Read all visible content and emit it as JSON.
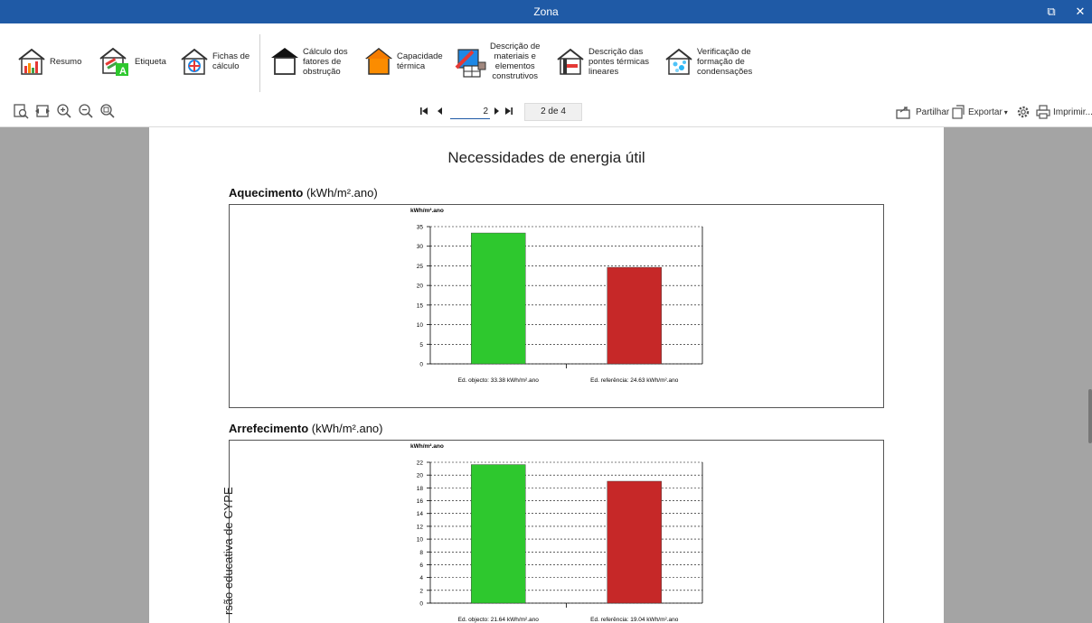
{
  "window": {
    "title": "Zona",
    "restore_glyph": "⧉",
    "close_glyph": "✕"
  },
  "ribbon": {
    "items": [
      {
        "label": "Resumo",
        "icon": "summary-chart-icon"
      },
      {
        "label": "Etiqueta",
        "icon": "label-icon"
      },
      {
        "label": "Fichas de\ncálculo",
        "icon": "calculation-sheets-icon"
      },
      {
        "label": "Cálculo dos\nfatores de\nobstrução",
        "icon": "obstruction-icon"
      },
      {
        "label": "Capacidade\ntérmica",
        "icon": "thermal-capacity-icon"
      },
      {
        "label": "Descrição de\nmateriais e\nelementos\nconstrutivos",
        "icon": "materials-icon"
      },
      {
        "label": "Descrição das\npontes térmicas\nlineares",
        "icon": "thermal-bridges-icon"
      },
      {
        "label": "Verificação de\nformação de\ncondensações",
        "icon": "condensation-icon"
      }
    ]
  },
  "toolbar": {
    "current_page": "2",
    "page_count": "2 de 4",
    "share_label": "Partilhar",
    "export_label": "Exportar",
    "print_label": "Imprimir..."
  },
  "document": {
    "heading": "Necessidades de energia útil",
    "watermark": "rsão educativa de CYPE",
    "sections": [
      {
        "title": "Aquecimento",
        "unit": "(kWh/m².ano)"
      },
      {
        "title": "Arrefecimento",
        "unit": "(kWh/m².ano)"
      }
    ]
  },
  "chart_data": [
    {
      "type": "bar",
      "ylabel": "kWh/m².ano",
      "categories": [
        "Ed. objecto: 33.38 kWh/m².ano",
        "Ed. referência: 24.63 kWh/m².ano"
      ],
      "values": [
        33.38,
        24.63
      ],
      "colors": [
        "#2ec82e",
        "#c62828"
      ],
      "ylim": [
        0,
        35
      ],
      "yticks": [
        0,
        5,
        10,
        15,
        20,
        25,
        30,
        35
      ],
      "grid": true
    },
    {
      "type": "bar",
      "ylabel": "kWh/m².ano",
      "categories": [
        "Ed. objecto: 21.64 kWh/m².ano",
        "Ed. referência: 19.04 kWh/m².ano"
      ],
      "values": [
        21.64,
        19.04
      ],
      "colors": [
        "#2ec82e",
        "#c62828"
      ],
      "ylim": [
        0,
        22
      ],
      "yticks": [
        0,
        2,
        4,
        6,
        8,
        10,
        12,
        14,
        16,
        18,
        20,
        22
      ],
      "grid": true
    }
  ]
}
